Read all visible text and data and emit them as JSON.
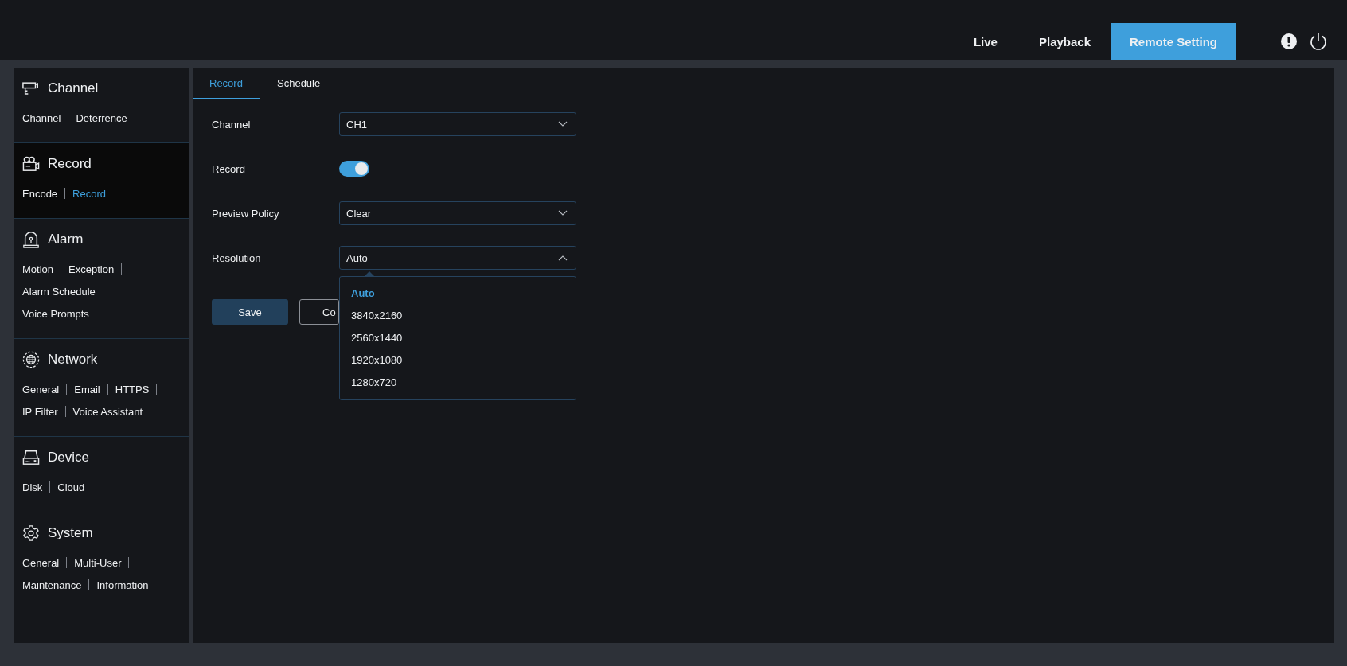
{
  "top_nav": [
    {
      "label": "Live",
      "selected": false
    },
    {
      "label": "Playback",
      "selected": false
    },
    {
      "label": "Remote Setting",
      "selected": true
    }
  ],
  "sidebar": {
    "sections": [
      {
        "title": "Channel",
        "selected": false,
        "link_rows": [
          [
            {
              "label": "Channel",
              "selected": false
            },
            {
              "label": "Deterrence",
              "selected": false
            }
          ]
        ]
      },
      {
        "title": "Record",
        "selected": true,
        "link_rows": [
          [
            {
              "label": "Encode",
              "selected": false
            },
            {
              "label": "Record",
              "selected": true
            }
          ]
        ]
      },
      {
        "title": "Alarm",
        "selected": false,
        "link_rows": [
          [
            {
              "label": "Motion",
              "selected": false
            },
            {
              "label": "Exception",
              "selected": false
            }
          ],
          [
            {
              "label": "Alarm Schedule",
              "selected": false
            }
          ],
          [
            {
              "label": "Voice Prompts",
              "selected": false
            }
          ]
        ]
      },
      {
        "title": "Network",
        "selected": false,
        "link_rows": [
          [
            {
              "label": "General",
              "selected": false
            },
            {
              "label": "Email",
              "selected": false
            },
            {
              "label": "HTTPS",
              "selected": false
            }
          ],
          [
            {
              "label": "IP Filter",
              "selected": false
            },
            {
              "label": "Voice Assistant",
              "selected": false
            }
          ]
        ]
      },
      {
        "title": "Device",
        "selected": false,
        "link_rows": [
          [
            {
              "label": "Disk",
              "selected": false
            },
            {
              "label": "Cloud",
              "selected": false
            }
          ]
        ]
      },
      {
        "title": "System",
        "selected": false,
        "link_rows": [
          [
            {
              "label": "General",
              "selected": false
            },
            {
              "label": "Multi-User",
              "selected": false
            }
          ],
          [
            {
              "label": "Maintenance",
              "selected": false
            },
            {
              "label": "Information",
              "selected": false
            }
          ]
        ]
      }
    ]
  },
  "tabs": [
    {
      "label": "Record",
      "selected": true
    },
    {
      "label": "Schedule",
      "selected": false
    }
  ],
  "form": [
    {
      "kind": "select",
      "label": "Channel",
      "value": "CH1",
      "expanded": false
    },
    {
      "kind": "toggle",
      "label": "Record",
      "on": true
    },
    {
      "kind": "select",
      "label": "Preview Policy",
      "value": "Clear",
      "expanded": false
    },
    {
      "kind": "select",
      "label": "Resolution",
      "value": "Auto",
      "expanded": true,
      "options": [
        {
          "label": "Auto",
          "selected": true
        },
        {
          "label": "3840x2160",
          "selected": false
        },
        {
          "label": "2560x1440",
          "selected": false
        },
        {
          "label": "1920x1080",
          "selected": false
        },
        {
          "label": "1280x720",
          "selected": false
        }
      ]
    }
  ],
  "buttons": [
    {
      "kind": "primary",
      "label": "Save"
    },
    {
      "kind": "outline",
      "label": "Co"
    }
  ]
}
